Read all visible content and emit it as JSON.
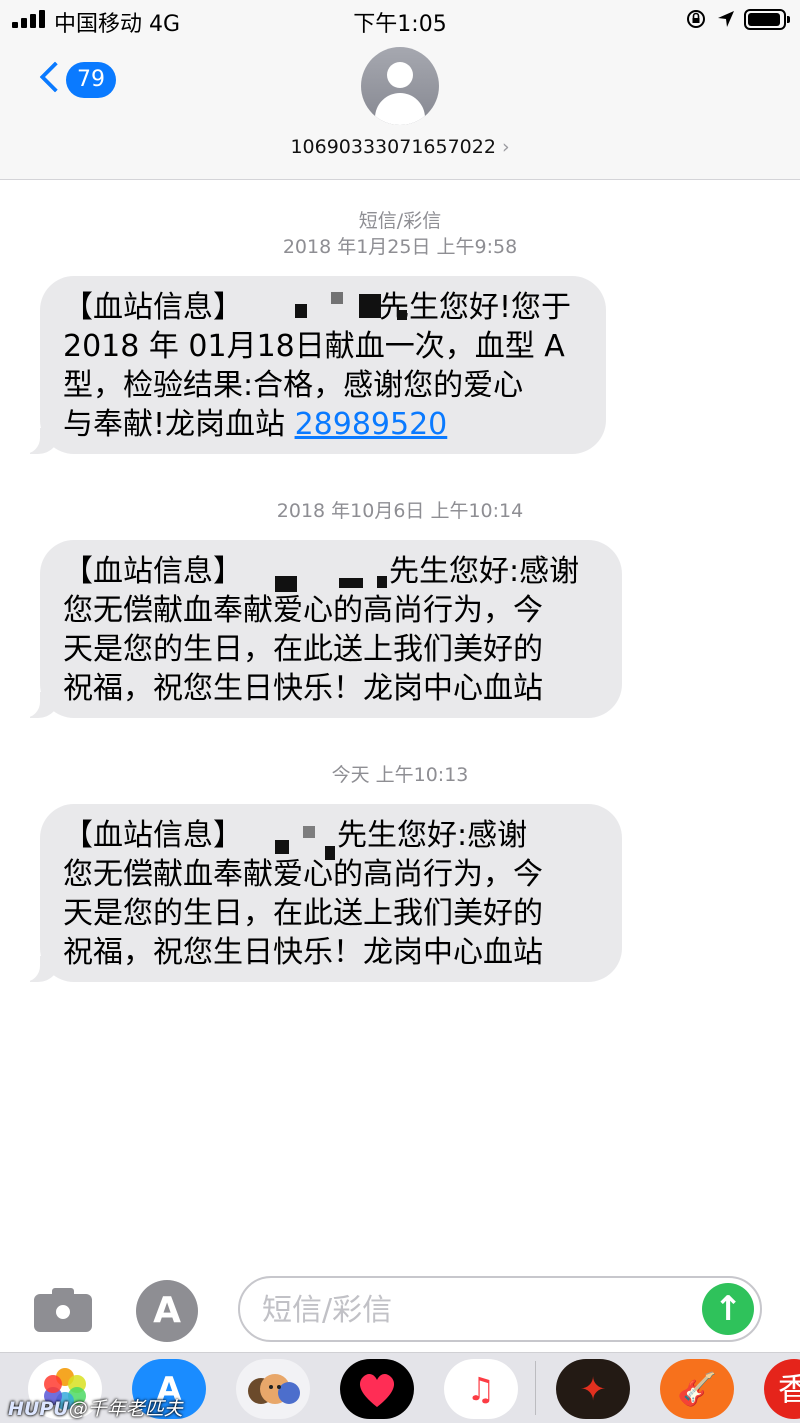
{
  "status_bar": {
    "carrier": "中国移动 4G",
    "time": "下午1:05"
  },
  "header": {
    "back_badge": "79",
    "contact": "10690333071657022",
    "contact_chevron": "›"
  },
  "thread": {
    "service_label": "短信/彩信",
    "messages": [
      {
        "timestamp": "2018 年1月25日 上午9:58",
        "lines": [
          "【血站信息】",
          "2018 年 01月18日献血一次，血型 A",
          "型，检验结果:合格，感谢您的爱心",
          "与奉献!龙岗血站 "
        ],
        "line1_suffix": "先生您好!您于",
        "link": "28989520"
      },
      {
        "timestamp": "2018 年10月6日 上午10:14",
        "lines": [
          "【血站信息】",
          "您无偿献血奉献爱心的高尚行为，今",
          "天是您的生日，在此送上我们美好的",
          "祝福，祝您生日快乐！龙岗中心血站"
        ],
        "line1_suffix": "先生您好:感谢"
      },
      {
        "timestamp": "今天 上午10:13",
        "lines": [
          "【血站信息】",
          "您无偿献血奉献爱心的高尚行为，今",
          "天是您的生日，在此送上我们美好的",
          "祝福，祝您生日快乐！龙岗中心血站"
        ],
        "line1_suffix": "先生您好:感谢"
      }
    ]
  },
  "compose": {
    "placeholder": "短信/彩信",
    "value": ""
  },
  "app_strip": {
    "icons": [
      "photos-icon",
      "app-store-icon",
      "memoji-icon",
      "digital-touch-icon",
      "music-icon",
      "game-icon",
      "garageband-icon",
      "red-app-icon"
    ],
    "label_red_app": "香"
  },
  "watermark": {
    "brand": "HUPU",
    "author": "@千年老匹夫"
  },
  "colors": {
    "accent": "#0a7aff",
    "bubble": "#e9e9eb",
    "send": "#2fc25b",
    "meta_text": "#8e8e93"
  }
}
